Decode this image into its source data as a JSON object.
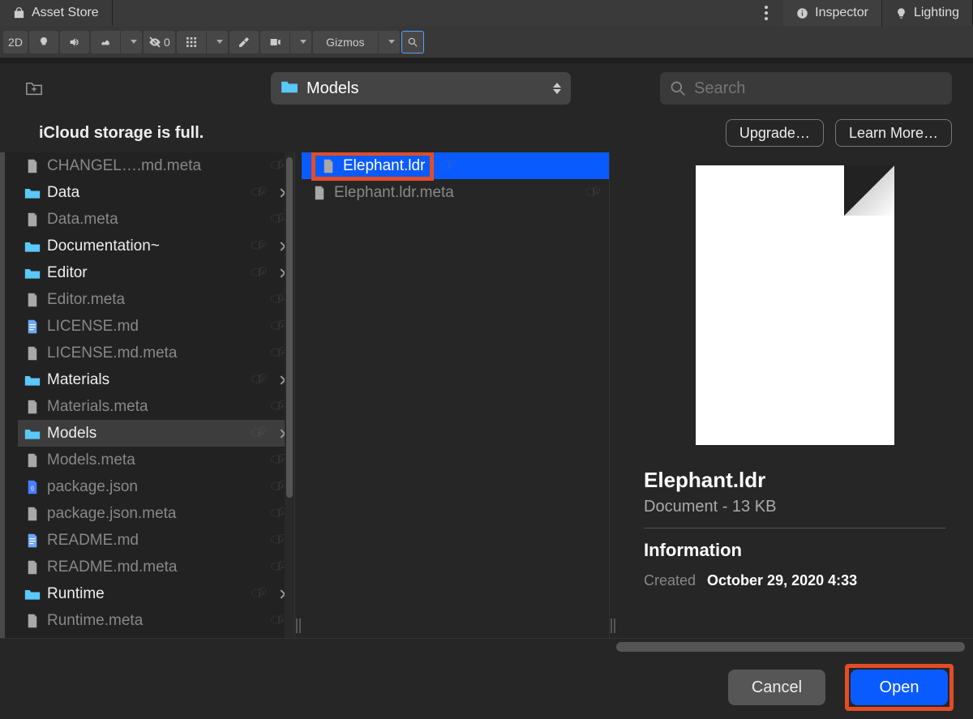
{
  "tabs": {
    "asset_store": "Asset Store",
    "inspector": "Inspector",
    "lighting": "Lighting"
  },
  "toolbar": {
    "btn_2d": "2D",
    "hidden_count": "0",
    "gizmos": "Gizmos"
  },
  "dialog": {
    "folder_name": "Models",
    "search_placeholder": "Search",
    "icloud_msg": "iCloud storage is full.",
    "upgrade": "Upgrade…",
    "learn_more": "Learn More…",
    "cancel": "Cancel",
    "open": "Open"
  },
  "col1": [
    {
      "type": "file",
      "name": "CHANGEL….md.meta",
      "dim": true,
      "cloud": true
    },
    {
      "type": "folder",
      "name": "Data",
      "dim": false,
      "cloud": true,
      "arrow": true
    },
    {
      "type": "file",
      "name": "Data.meta",
      "dim": true,
      "cloud": true
    },
    {
      "type": "folder",
      "name": "Documentation~",
      "dim": false,
      "cloud": true,
      "arrow": true
    },
    {
      "type": "folder",
      "name": "Editor",
      "dim": false,
      "cloud": true,
      "arrow": true
    },
    {
      "type": "file",
      "name": "Editor.meta",
      "dim": true,
      "cloud": true
    },
    {
      "type": "mdfile",
      "name": "LICENSE.md",
      "dim": true,
      "cloud": true
    },
    {
      "type": "file",
      "name": "LICENSE.md.meta",
      "dim": true,
      "cloud": true
    },
    {
      "type": "folder",
      "name": "Materials",
      "dim": false,
      "cloud": true,
      "arrow": true
    },
    {
      "type": "file",
      "name": "Materials.meta",
      "dim": true,
      "cloud": true
    },
    {
      "type": "folder",
      "name": "Models",
      "dim": false,
      "cloud": true,
      "arrow": true,
      "active": true
    },
    {
      "type": "file",
      "name": "Models.meta",
      "dim": true,
      "cloud": true
    },
    {
      "type": "jsonfile",
      "name": "package.json",
      "dim": true,
      "cloud": true
    },
    {
      "type": "file",
      "name": "package.json.meta",
      "dim": true,
      "cloud": true
    },
    {
      "type": "mdfile",
      "name": "README.md",
      "dim": true,
      "cloud": true
    },
    {
      "type": "file",
      "name": "README.md.meta",
      "dim": true,
      "cloud": true
    },
    {
      "type": "folder",
      "name": "Runtime",
      "dim": false,
      "cloud": true,
      "arrow": true
    },
    {
      "type": "file",
      "name": "Runtime.meta",
      "dim": true,
      "cloud": true
    }
  ],
  "col2": [
    {
      "type": "file",
      "name": "Elephant.ldr",
      "selected": true,
      "highlight": true,
      "cloud": true
    },
    {
      "type": "file",
      "name": "Elephant.ldr.meta",
      "dim": true,
      "cloud": true
    }
  ],
  "preview": {
    "title": "Elephant.ldr",
    "subtitle": "Document - 13 KB",
    "info_header": "Information",
    "created_label": "Created",
    "created_value": "October 29, 2020 4:33"
  }
}
